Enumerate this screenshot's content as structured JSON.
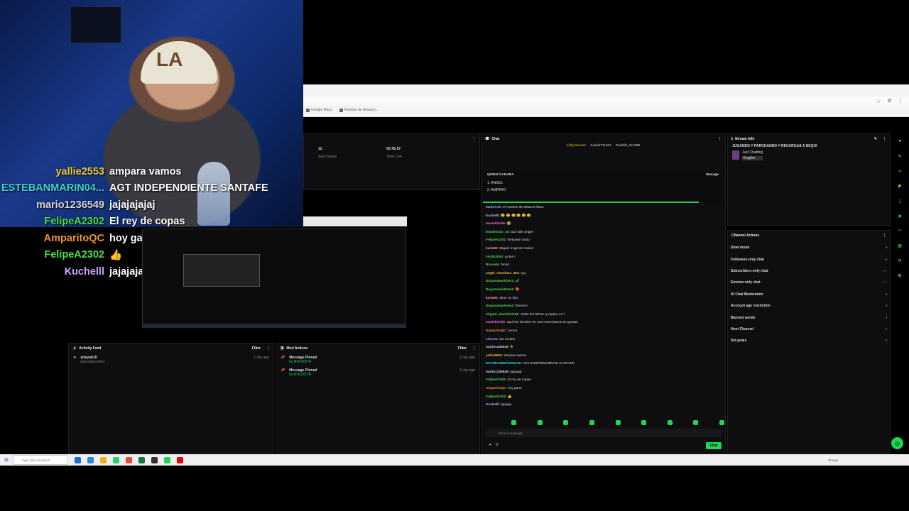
{
  "overlay_chat": [
    {
      "user": "yallie2553",
      "color": "#f0c43a",
      "msg": "ampara vamos"
    },
    {
      "user": "ESTEBANMARIN04...",
      "color": "#3fd0d0",
      "msg": "AGT INDEPENDIENTE SANTAFE"
    },
    {
      "user": "mario1236549",
      "color": "#d8d8d8",
      "msg": "jajajajajaj"
    },
    {
      "user": "FelipeA2302",
      "color": "#4bdc4b",
      "msg": "El rey de copas"
    },
    {
      "user": "AmparitoQC",
      "color": "#f0932b",
      "msg": "hoy gano"
    },
    {
      "user": "FelipeA2302",
      "color": "#4bdc4b",
      "msg": "👍"
    },
    {
      "user": "Kuchelll",
      "color": "#c9a0ff",
      "msg": "jajajaja"
    }
  ],
  "browser": {
    "bookmarks": [
      "Google Maps",
      "Noticias de Amazon..."
    ]
  },
  "stats": {
    "sub_count_value": "12",
    "sub_count_label": "Sub Counts",
    "time_live_value": "00:45:57",
    "time_live_label": "Time Live"
  },
  "activity_feed": {
    "title": "Activity Feed",
    "filter": "Filter",
    "items": [
      {
        "user": "arleyab10",
        "desc": "just subscribed",
        "time": "1 day ago"
      }
    ]
  },
  "mod_actions": {
    "title": "Mod Actions",
    "filter": "Filter",
    "items": [
      {
        "title": "Message Pinned",
        "by": "by ROLOSTR",
        "time": "1 day ago"
      },
      {
        "title": "Message Pinned",
        "by": "by ROLOSTR",
        "time": "1 day ago"
      }
    ]
  },
  "chat": {
    "title": "Chat",
    "top_users": [
      "richymendez",
      "Juani2711201",
      "Paublitt_112328"
    ],
    "pinned_title": "QUIEN GANARA",
    "pinned_manage": "Manage",
    "pinned_options": [
      "1. ANGEL",
      "2. AMPARO"
    ],
    "messages": [
      {
        "user": "MaiteAsh",
        "color": "#8fb0ff",
        "text": "el nombre de tokazos flosa"
      },
      {
        "user": "Kuchelll",
        "color": "#c9a0ff",
        "text": "😀 😀 😀 😀 😀 😀"
      },
      {
        "user": "marielloride",
        "color": "#ff6bd6",
        "text": "🟢"
      },
      {
        "user": "brandon22_10",
        "color": "#4bdc4b",
        "text": "acá sale angel"
      },
      {
        "user": "FelipeA2302",
        "color": "#4bdc4b",
        "text": "Respeta chato"
      },
      {
        "user": "karla90",
        "color": "#ff9f9f",
        "text": "Miguel in gento maleo!"
      },
      {
        "user": "vivi102000",
        "color": "#4bdc4b",
        "text": "ya les i"
      },
      {
        "user": "Rossato",
        "color": "#4bdc4b",
        "text": "Nooo"
      },
      {
        "user": "angel_mendoza_403",
        "color": "#f0c43a",
        "text": "uyy"
      },
      {
        "user": "Dayanamartinezz",
        "color": "#4bdc4b",
        "text": "🥒"
      },
      {
        "user": "Dayanamartinezz",
        "color": "#4bdc4b",
        "text": "🍓"
      },
      {
        "user": "karla90",
        "color": "#ff9f9f",
        "text": "dime un hijo"
      },
      {
        "user": "Dayanamartinezz",
        "color": "#4bdc4b",
        "text": "Romero"
      },
      {
        "user": "miguel_davidrielo08",
        "color": "#4bdc4b",
        "text": "chato les bilnes q equipo es ?"
      },
      {
        "user": "marielloride",
        "color": "#ff6bd6",
        "text": "aquí los hombre en sus comentarios se guetan"
      },
      {
        "user": "AmparitoQC",
        "color": "#f0932b",
        "text": "ooooo"
      },
      {
        "user": "ciooerz",
        "color": "#8fb0ff",
        "text": "los verdes"
      },
      {
        "user": "mario1236549",
        "color": "#d8d8d8",
        "text": "🐓"
      },
      {
        "user": "yallie2553",
        "color": "#f0c43a",
        "text": "ampara vamos"
      },
      {
        "user": "ESTEBANMARIN0410",
        "color": "#3fd0d0",
        "text": "AGT INDEPENDIENTE SANTAFE"
      },
      {
        "user": "mario1236549",
        "color": "#d8d8d8",
        "text": "jajajajaj"
      },
      {
        "user": "FelipeA2302",
        "color": "#4bdc4b",
        "text": "El rey de copas"
      },
      {
        "user": "AmparitoQC",
        "color": "#f0932b",
        "text": "hoy gano"
      },
      {
        "user": "FelipeA2302",
        "color": "#4bdc4b",
        "text": "👍"
      },
      {
        "user": "Kuchelll",
        "color": "#c9a0ff",
        "text": "jajajaja"
      }
    ],
    "send_placeholder": "Send a message",
    "points": "0",
    "chat_button": "Chat"
  },
  "stream_info": {
    "title": "Stream Info",
    "stream_title": "JUGANDO Y PARCHANDO Y RECARGAS A NEQUI",
    "category": "Just Chatting",
    "language": "English"
  },
  "channel_actions": {
    "title": "Channel Actions",
    "items": [
      "Slow mode",
      "Followers-only chat",
      "Subscribers-only chat",
      "Emotes-only chat",
      "AI Chat Moderation",
      "Account age restriction",
      "Banned words",
      "Host Channel",
      "Set goals"
    ]
  },
  "taskbar": {
    "search_placeholder": "Type here to search",
    "weather": "Cloudy"
  },
  "colors": {
    "accent": "#1fd655",
    "panel": "#0e0e10"
  }
}
